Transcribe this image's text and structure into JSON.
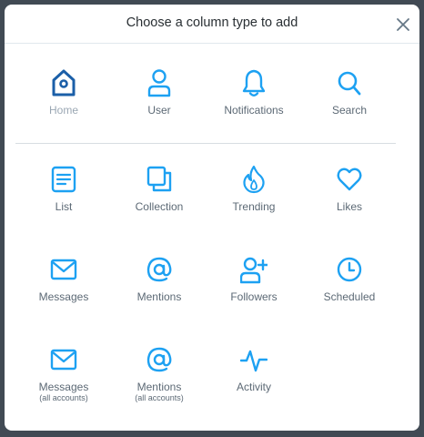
{
  "dialog": {
    "title": "Choose a column type to add",
    "close_label": "×"
  },
  "colors": {
    "icon_accent": "#1da1f2",
    "home_icon": "#1b5fa8",
    "label": "#5c6975",
    "muted_label": "#9aa7b3"
  },
  "columns": {
    "home": {
      "label": "Home",
      "icon": "birdhouse-icon"
    },
    "user": {
      "label": "User",
      "icon": "user-icon"
    },
    "notifications": {
      "label": "Notifications",
      "icon": "bell-icon"
    },
    "search": {
      "label": "Search",
      "icon": "search-icon"
    },
    "list": {
      "label": "List",
      "icon": "list-icon"
    },
    "collection": {
      "label": "Collection",
      "icon": "collection-icon"
    },
    "trending": {
      "label": "Trending",
      "icon": "flame-icon"
    },
    "likes": {
      "label": "Likes",
      "icon": "heart-icon"
    },
    "messages": {
      "label": "Messages",
      "icon": "envelope-icon"
    },
    "mentions": {
      "label": "Mentions",
      "icon": "at-icon"
    },
    "followers": {
      "label": "Followers",
      "icon": "user-plus-icon"
    },
    "scheduled": {
      "label": "Scheduled",
      "icon": "clock-icon"
    },
    "messages_all": {
      "label": "Messages",
      "sub": "(all accounts)",
      "icon": "envelope-icon"
    },
    "mentions_all": {
      "label": "Mentions",
      "sub": "(all accounts)",
      "icon": "at-icon"
    },
    "activity": {
      "label": "Activity",
      "icon": "activity-icon"
    }
  }
}
